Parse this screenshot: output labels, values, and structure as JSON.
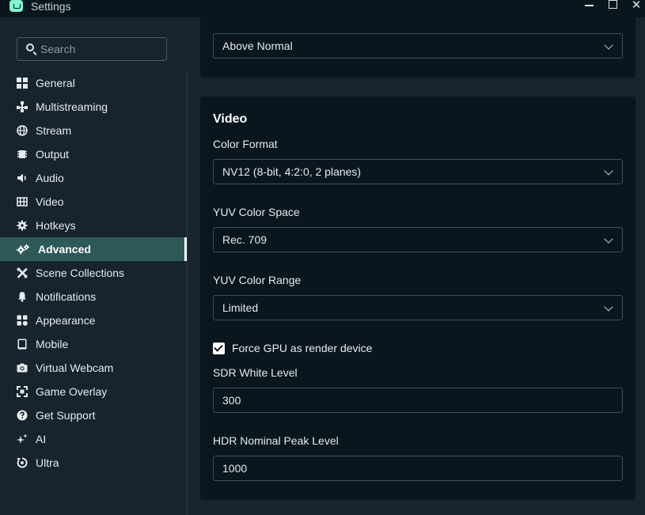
{
  "window": {
    "title": "Settings",
    "close_glyph": "✕"
  },
  "search": {
    "placeholder": "Search",
    "value": ""
  },
  "sidebar": {
    "items": [
      {
        "label": "General",
        "icon": "grid-icon"
      },
      {
        "label": "Multistreaming",
        "icon": "multistream-icon"
      },
      {
        "label": "Stream",
        "icon": "globe-icon"
      },
      {
        "label": "Output",
        "icon": "chip-icon"
      },
      {
        "label": "Audio",
        "icon": "speaker-icon"
      },
      {
        "label": "Video",
        "icon": "film-icon"
      },
      {
        "label": "Hotkeys",
        "icon": "gear-icon"
      },
      {
        "label": "Advanced",
        "icon": "gears-icon",
        "active": true
      },
      {
        "label": "Scene Collections",
        "icon": "tools-icon"
      },
      {
        "label": "Notifications",
        "icon": "bell-icon"
      },
      {
        "label": "Appearance",
        "icon": "puzzle-icon"
      },
      {
        "label": "Mobile",
        "icon": "tablet-icon"
      },
      {
        "label": "Virtual Webcam",
        "icon": "camera-icon"
      },
      {
        "label": "Game Overlay",
        "icon": "overlay-icon"
      },
      {
        "label": "Get Support",
        "icon": "help-icon"
      },
      {
        "label": "AI",
        "icon": "sparkle-icon"
      },
      {
        "label": "Ultra",
        "icon": "ultra-icon"
      }
    ]
  },
  "top_panel": {
    "priority_value": "Above Normal"
  },
  "video": {
    "title": "Video",
    "color_format": {
      "label": "Color Format",
      "value": "NV12 (8-bit, 4:2:0, 2 planes)"
    },
    "yuv_color_space": {
      "label": "YUV Color Space",
      "value": "Rec. 709"
    },
    "yuv_color_range": {
      "label": "YUV Color Range",
      "value": "Limited"
    },
    "force_gpu": {
      "label": "Force GPU as render device",
      "checked": true
    },
    "sdr_white_level": {
      "label": "SDR White Level",
      "value": "300"
    },
    "hdr_nominal_peak": {
      "label": "HDR Nominal Peak Level",
      "value": "1000"
    }
  },
  "colors": {
    "background": "#17242d",
    "panel": "#09161d",
    "active_item": "#2d5a58",
    "logo": "#80f5d2"
  }
}
